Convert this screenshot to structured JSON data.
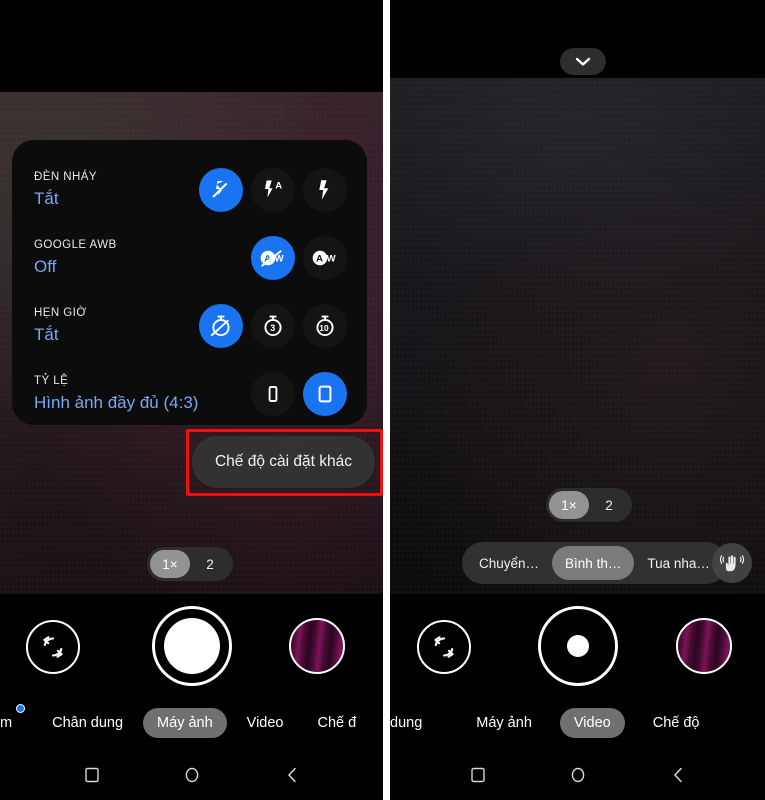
{
  "left_phone": {
    "settings_sheet": {
      "rows": [
        {
          "title": "ĐÈN NHÁY",
          "value": "Tắt",
          "options": [
            {
              "icon": "flash-off-icon",
              "selected": true
            },
            {
              "icon": "flash-auto-icon",
              "selected": false
            },
            {
              "icon": "flash-on-icon",
              "selected": false
            }
          ]
        },
        {
          "title": "GOOGLE AWB",
          "value": "Off",
          "options": [
            {
              "icon": "awb-off-icon",
              "selected": true
            },
            {
              "icon": "awb-on-icon",
              "selected": false
            }
          ]
        },
        {
          "title": "HẸN GIỜ",
          "value": "Tắt",
          "options": [
            {
              "icon": "timer-off-icon",
              "selected": true
            },
            {
              "icon": "timer-3s-icon",
              "selected": false
            },
            {
              "icon": "timer-10s-icon",
              "selected": false
            }
          ]
        },
        {
          "title": "TỶ LỆ",
          "value": "Hình ảnh đầy đủ (4:3)",
          "options": [
            {
              "icon": "aspect-16-9-icon",
              "selected": false
            },
            {
              "icon": "aspect-4-3-icon",
              "selected": true
            }
          ]
        }
      ]
    },
    "more_settings_label": "Chế độ cài đặt khác",
    "zoom": {
      "options": [
        "1×",
        "2"
      ],
      "active_index": 0
    },
    "shutter": {
      "icon": "shutter-photo-icon"
    },
    "flip_camera": {
      "icon": "flip-camera-icon"
    },
    "gallery_thumbnail": {
      "icon": "gallery-thumbnail"
    },
    "modes": [
      {
        "label": "m",
        "active": false,
        "dot": true
      },
      {
        "label": "Chân dung",
        "active": false
      },
      {
        "label": "Máy ảnh",
        "active": true
      },
      {
        "label": "Video",
        "active": false
      },
      {
        "label": "Chế đ",
        "active": false
      }
    ]
  },
  "right_phone": {
    "collapse_button": {
      "icon": "chevron-down-icon"
    },
    "zoom": {
      "options": [
        "1×",
        "2"
      ],
      "active_index": 0
    },
    "speed_bar": {
      "options": [
        {
          "label": "Chuyển…",
          "active": false
        },
        {
          "label": "Bình th…",
          "active": true
        },
        {
          "label": "Tua nha…",
          "active": false
        }
      ],
      "stabilization": {
        "icon": "stabilization-hand-icon"
      }
    },
    "shutter": {
      "icon": "shutter-video-icon"
    },
    "flip_camera": {
      "icon": "flip-camera-icon"
    },
    "gallery_thumbnail": {
      "icon": "gallery-thumbnail"
    },
    "modes": [
      {
        "label": "dung",
        "active": false
      },
      {
        "label": "Máy ảnh",
        "active": false
      },
      {
        "label": "Video",
        "active": true
      },
      {
        "label": "Chế độ",
        "active": false
      }
    ]
  },
  "nav_bar": {
    "items": [
      {
        "icon": "recents-square-icon"
      },
      {
        "icon": "home-circle-icon"
      },
      {
        "icon": "back-chevron-icon"
      }
    ]
  },
  "colors": {
    "accent_blue": "#1a73f0",
    "value_text_blue": "#7aa7f0",
    "highlight_red": "#ee1111"
  }
}
